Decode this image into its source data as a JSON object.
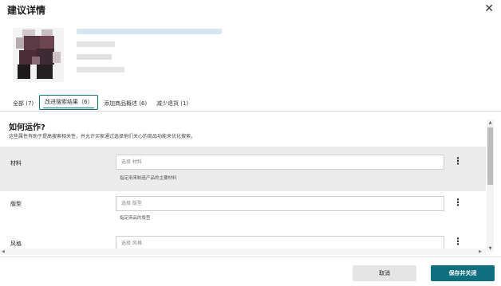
{
  "dialog": {
    "title": "建议详情",
    "close_icon": "close-icon"
  },
  "tabs": [
    {
      "label": "全部 (7)",
      "active": false
    },
    {
      "label": "改进搜索结果（6）",
      "active": true
    },
    {
      "label": "添加商品概述 (6)",
      "active": false
    },
    {
      "label": "减少退货 (1)",
      "active": false
    }
  ],
  "section": {
    "title": "如何运作?",
    "description": "这些属性有助于提高搜索相关性，并允许买家通过选择他们关心的商品功能来优化搜索。"
  },
  "attributes": [
    {
      "label": "材料",
      "placeholder": "选择 材料",
      "hint": "指定用来制造产品的主要材料"
    },
    {
      "label": "版型",
      "placeholder": "选择 版型",
      "hint": "指定商品的版型"
    },
    {
      "label": "风格",
      "placeholder": "选择 风格",
      "hint": ""
    }
  ],
  "kebab_symbol": "⋮",
  "footer": {
    "cancel_label": "取消",
    "save_label": "保存并关闭"
  },
  "colors": {
    "accent": "#0f6f7f",
    "shaded_row": "#ececec"
  }
}
